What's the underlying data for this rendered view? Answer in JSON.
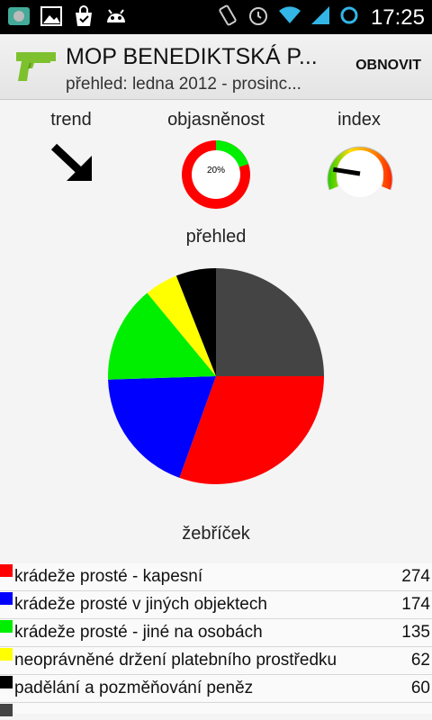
{
  "status_bar": {
    "time": "17:25",
    "icons": [
      "app-notification-icon",
      "image-icon",
      "shopping-bag-icon",
      "android-icon",
      "vibrate-icon",
      "alarm-icon",
      "wifi-icon",
      "signal-icon",
      "battery-icon"
    ]
  },
  "action_bar": {
    "title": "MOP BENEDIKTSKÁ P...",
    "subtitle": "přehled: ledna 2012 - prosinc...",
    "refresh_label": "OBNOVIT"
  },
  "indicators": {
    "trend_label": "trend",
    "clearance_label": "objasněnost",
    "clearance_value": "20%",
    "clearance_fraction": 0.2,
    "index_label": "index",
    "index_level": 0.2
  },
  "overview_title": "přehled",
  "ranking_title": "žebříček",
  "colors": {
    "red": "#ff0000",
    "blue": "#0000ff",
    "green": "#00ee00",
    "yellow": "#ffff00",
    "black": "#000000",
    "darkgray": "#444444"
  },
  "chart_data": {
    "type": "pie",
    "start": "top, clockwise",
    "slices": [
      {
        "color": "#444444",
        "value": 0.25
      },
      {
        "color": "#ff0000",
        "value": 0.305
      },
      {
        "color": "#0000ff",
        "value": 0.19
      },
      {
        "color": "#00ee00",
        "value": 0.145
      },
      {
        "color": "#ffff00",
        "value": 0.05
      },
      {
        "color": "#000000",
        "value": 0.06
      }
    ]
  },
  "ranking": [
    {
      "label": "krádeže prosté - kapesní",
      "value": "274",
      "color": "#ff0000"
    },
    {
      "label": "krádeže prosté v jiných objektech",
      "value": "174",
      "color": "#0000ff"
    },
    {
      "label": "krádeže prosté - jiné na osobách",
      "value": "135",
      "color": "#00ee00"
    },
    {
      "label": "neoprávněné držení platebního prostředku",
      "value": "62",
      "color": "#ffff00"
    },
    {
      "label": "padělání a pozměňování peněz",
      "value": "60",
      "color": "#000000"
    }
  ]
}
